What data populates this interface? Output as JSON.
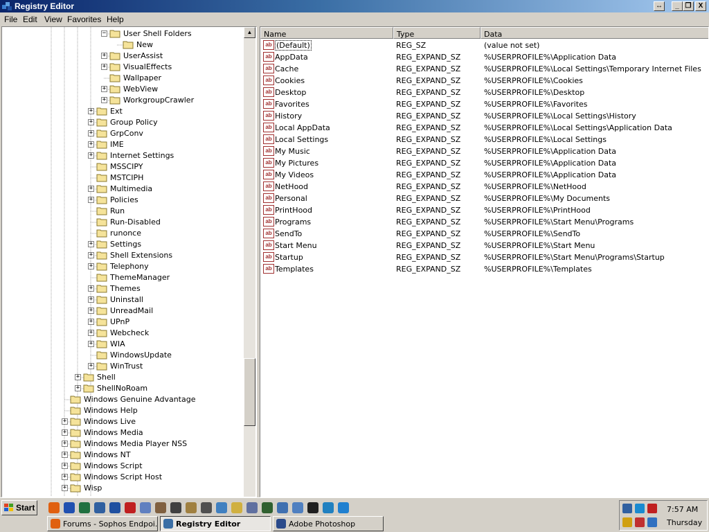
{
  "window": {
    "title": "Registry Editor",
    "buttons": {
      "restore_label": "↔",
      "minimize_label": "_",
      "maximize_label": "❐",
      "close_label": "X"
    }
  },
  "menu": [
    "File",
    "Edit",
    "View",
    "Favorites",
    "Help"
  ],
  "tree": [
    {
      "label": "User Shell Folders",
      "level": 3,
      "expander": "minus",
      "open": true
    },
    {
      "label": "New",
      "level": 4,
      "expander": "none"
    },
    {
      "label": "UserAssist",
      "level": 3,
      "expander": "plus"
    },
    {
      "label": "VisualEffects",
      "level": 3,
      "expander": "plus"
    },
    {
      "label": "Wallpaper",
      "level": 3,
      "expander": "none"
    },
    {
      "label": "WebView",
      "level": 3,
      "expander": "plus"
    },
    {
      "label": "WorkgroupCrawler",
      "level": 3,
      "expander": "plus"
    },
    {
      "label": "Ext",
      "level": 2,
      "expander": "plus"
    },
    {
      "label": "Group Policy",
      "level": 2,
      "expander": "plus"
    },
    {
      "label": "GrpConv",
      "level": 2,
      "expander": "plus"
    },
    {
      "label": "IME",
      "level": 2,
      "expander": "plus"
    },
    {
      "label": "Internet Settings",
      "level": 2,
      "expander": "plus"
    },
    {
      "label": "MSSCIPY",
      "level": 2,
      "expander": "none"
    },
    {
      "label": "MSTCIPH",
      "level": 2,
      "expander": "none"
    },
    {
      "label": "Multimedia",
      "level": 2,
      "expander": "plus"
    },
    {
      "label": "Policies",
      "level": 2,
      "expander": "plus"
    },
    {
      "label": "Run",
      "level": 2,
      "expander": "none"
    },
    {
      "label": "Run-Disabled",
      "level": 2,
      "expander": "none"
    },
    {
      "label": "runonce",
      "level": 2,
      "expander": "none"
    },
    {
      "label": "Settings",
      "level": 2,
      "expander": "plus"
    },
    {
      "label": "Shell Extensions",
      "level": 2,
      "expander": "plus"
    },
    {
      "label": "Telephony",
      "level": 2,
      "expander": "plus"
    },
    {
      "label": "ThemeManager",
      "level": 2,
      "expander": "none"
    },
    {
      "label": "Themes",
      "level": 2,
      "expander": "plus"
    },
    {
      "label": "Uninstall",
      "level": 2,
      "expander": "plus"
    },
    {
      "label": "UnreadMail",
      "level": 2,
      "expander": "plus"
    },
    {
      "label": "UPnP",
      "level": 2,
      "expander": "plus"
    },
    {
      "label": "Webcheck",
      "level": 2,
      "expander": "plus"
    },
    {
      "label": "WIA",
      "level": 2,
      "expander": "plus"
    },
    {
      "label": "WindowsUpdate",
      "level": 2,
      "expander": "none"
    },
    {
      "label": "WinTrust",
      "level": 2,
      "expander": "plus"
    },
    {
      "label": "Shell",
      "level": 1,
      "expander": "plus"
    },
    {
      "label": "ShellNoRoam",
      "level": 1,
      "expander": "plus"
    },
    {
      "label": "Windows Genuine Advantage",
      "level": 0,
      "expander": "none"
    },
    {
      "label": "Windows Help",
      "level": 0,
      "expander": "none"
    },
    {
      "label": "Windows Live",
      "level": 0,
      "expander": "plus"
    },
    {
      "label": "Windows Media",
      "level": 0,
      "expander": "plus"
    },
    {
      "label": "Windows Media Player NSS",
      "level": 0,
      "expander": "plus"
    },
    {
      "label": "Windows NT",
      "level": 0,
      "expander": "plus"
    },
    {
      "label": "Windows Script",
      "level": 0,
      "expander": "plus"
    },
    {
      "label": "Windows Script Host",
      "level": 0,
      "expander": "plus"
    },
    {
      "label": "Wisp",
      "level": 0,
      "expander": "plus"
    }
  ],
  "list": {
    "columns": [
      "Name",
      "Type",
      "Data"
    ],
    "rows": [
      {
        "name": "(Default)",
        "type": "REG_SZ",
        "data": "(value not set)",
        "selected": true
      },
      {
        "name": "AppData",
        "type": "REG_EXPAND_SZ",
        "data": "%USERPROFILE%\\Application Data"
      },
      {
        "name": "Cache",
        "type": "REG_EXPAND_SZ",
        "data": "%USERPROFILE%\\Local Settings\\Temporary Internet Files"
      },
      {
        "name": "Cookies",
        "type": "REG_EXPAND_SZ",
        "data": "%USERPROFILE%\\Cookies"
      },
      {
        "name": "Desktop",
        "type": "REG_EXPAND_SZ",
        "data": "%USERPROFILE%\\Desktop"
      },
      {
        "name": "Favorites",
        "type": "REG_EXPAND_SZ",
        "data": "%USERPROFILE%\\Favorites"
      },
      {
        "name": "History",
        "type": "REG_EXPAND_SZ",
        "data": "%USERPROFILE%\\Local Settings\\History"
      },
      {
        "name": "Local AppData",
        "type": "REG_EXPAND_SZ",
        "data": "%USERPROFILE%\\Local Settings\\Application Data"
      },
      {
        "name": "Local Settings",
        "type": "REG_EXPAND_SZ",
        "data": "%USERPROFILE%\\Local Settings"
      },
      {
        "name": "My Music",
        "type": "REG_EXPAND_SZ",
        "data": "%USERPROFILE%\\Application Data"
      },
      {
        "name": "My Pictures",
        "type": "REG_EXPAND_SZ",
        "data": "%USERPROFILE%\\Application Data"
      },
      {
        "name": "My Videos",
        "type": "REG_EXPAND_SZ",
        "data": "%USERPROFILE%\\Application Data"
      },
      {
        "name": "NetHood",
        "type": "REG_EXPAND_SZ",
        "data": "%USERPROFILE%\\NetHood"
      },
      {
        "name": "Personal",
        "type": "REG_EXPAND_SZ",
        "data": "%USERPROFILE%\\My Documents"
      },
      {
        "name": "PrintHood",
        "type": "REG_EXPAND_SZ",
        "data": "%USERPROFILE%\\PrintHood"
      },
      {
        "name": "Programs",
        "type": "REG_EXPAND_SZ",
        "data": "%USERPROFILE%\\Start Menu\\Programs"
      },
      {
        "name": "SendTo",
        "type": "REG_EXPAND_SZ",
        "data": "%USERPROFILE%\\SendTo"
      },
      {
        "name": "Start Menu",
        "type": "REG_EXPAND_SZ",
        "data": "%USERPROFILE%\\Start Menu"
      },
      {
        "name": "Startup",
        "type": "REG_EXPAND_SZ",
        "data": "%USERPROFILE%\\Start Menu\\Programs\\Startup"
      },
      {
        "name": "Templates",
        "type": "REG_EXPAND_SZ",
        "data": "%USERPROFILE%\\Templates"
      }
    ]
  },
  "value_icon_text": "ab",
  "taskbar": {
    "start_label": "Start",
    "tasks": [
      {
        "label": "Forums - Sophos Endpoi...",
        "icon_color": "#e06010",
        "icon": "firefox-icon"
      },
      {
        "label": "Registry Editor",
        "icon_color": "#3a6ea5",
        "icon": "regedit-icon",
        "active": true
      },
      {
        "label": "Adobe Photoshop",
        "icon_color": "#2a4a8a",
        "icon": "photoshop-icon"
      }
    ],
    "quick_launch": [
      {
        "icon": "firefox-icon",
        "color": "#e06010"
      },
      {
        "icon": "app-blue-icon",
        "color": "#2050b0"
      },
      {
        "icon": "excel-icon",
        "color": "#207040"
      },
      {
        "icon": "globe-icon",
        "color": "#3060a0"
      },
      {
        "icon": "word-icon",
        "color": "#2050a0"
      },
      {
        "icon": "pdf-icon",
        "color": "#c02020"
      },
      {
        "icon": "notepad-icon",
        "color": "#6080c0"
      },
      {
        "icon": "tools-icon",
        "color": "#806040"
      },
      {
        "icon": "arrows-icon",
        "color": "#404040"
      },
      {
        "icon": "photo-icon",
        "color": "#a08040"
      },
      {
        "icon": "lock-icon",
        "color": "#505050"
      },
      {
        "icon": "person-icon",
        "color": "#4080c0"
      },
      {
        "icon": "folder-icon",
        "color": "#d0b040"
      },
      {
        "icon": "network-icon",
        "color": "#6070a0"
      },
      {
        "icon": "terminal-icon",
        "color": "#306030"
      },
      {
        "icon": "chart-icon",
        "color": "#4070b0"
      },
      {
        "icon": "cd-icon",
        "color": "#5080c0"
      },
      {
        "icon": "x-icon",
        "color": "#202020"
      },
      {
        "icon": "c-icon",
        "color": "#2080c0"
      },
      {
        "icon": "ie-icon",
        "color": "#2080d0"
      }
    ],
    "tray": {
      "time": "7:57 AM",
      "day": "Thursday",
      "icons": [
        {
          "icon": "network-tray-icon",
          "color": "#3060a0"
        },
        {
          "icon": "teamviewer-icon",
          "color": "#1a8ad0"
        },
        {
          "icon": "shield-tray-icon",
          "color": "#c02020"
        },
        {
          "icon": "warning-tray-icon",
          "color": "#d0a010"
        },
        {
          "icon": "disconnected-icon",
          "color": "#c03030"
        },
        {
          "icon": "sync-icon",
          "color": "#3070c0"
        }
      ]
    }
  }
}
